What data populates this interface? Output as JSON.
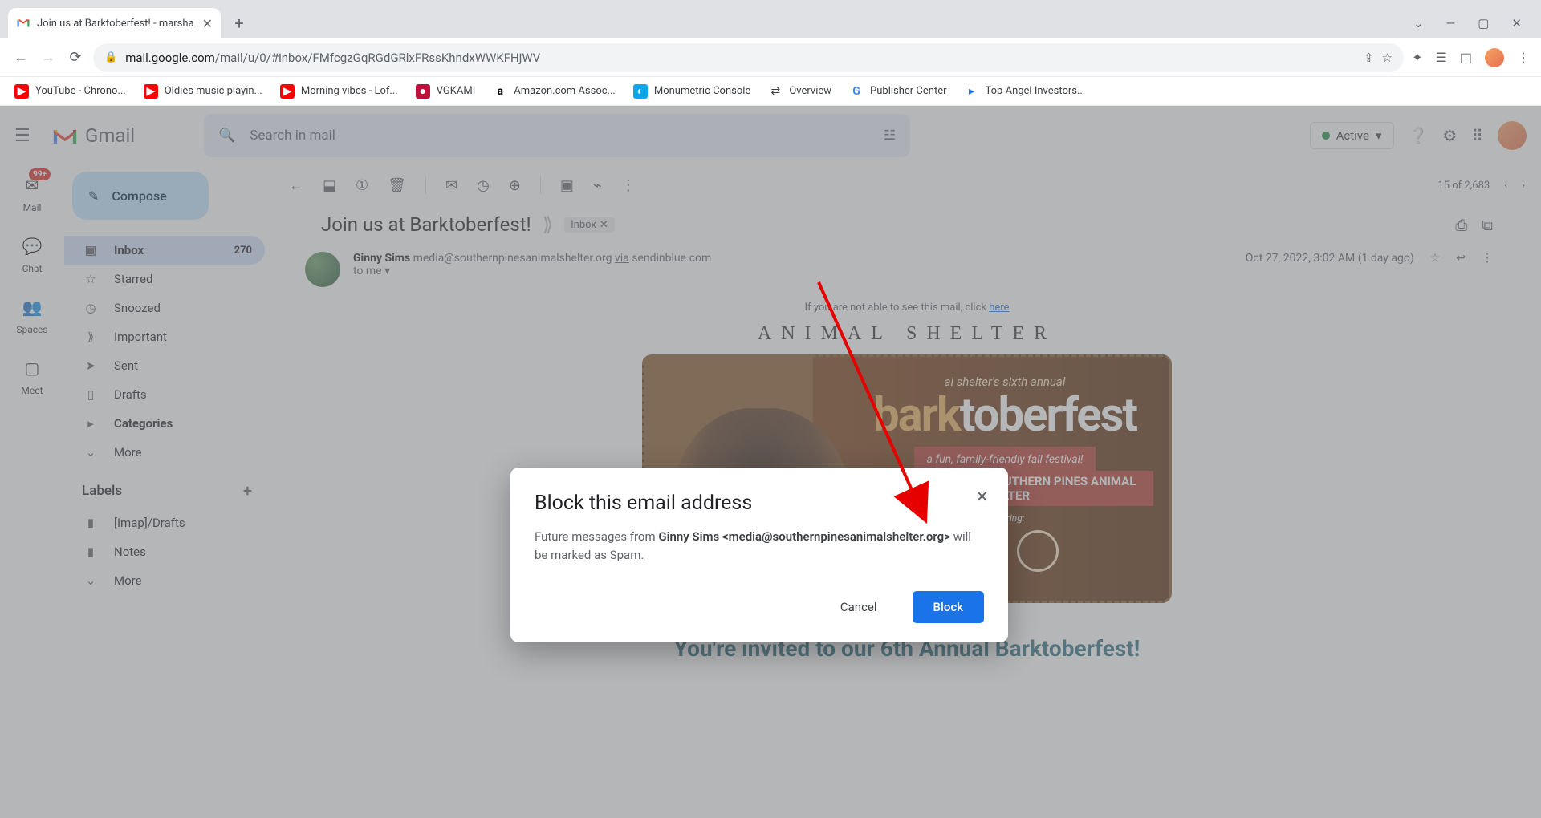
{
  "browser": {
    "tab_title": "Join us at Barktoberfest! - marsha",
    "url_domain": "mail.google.com",
    "url_path": "/mail/u/0/#inbox/FMfcgzGqRGdGRlxFRssKhndxWWKFHjWV",
    "bookmarks": [
      {
        "label": "YouTube - Chrono..."
      },
      {
        "label": "Oldies music playin..."
      },
      {
        "label": "Morning vibes - Lof..."
      },
      {
        "label": "VGKAMI"
      },
      {
        "label": "Amazon.com Assoc..."
      },
      {
        "label": "Monumetric Console"
      },
      {
        "label": "Overview"
      },
      {
        "label": "Publisher Center"
      },
      {
        "label": "Top Angel Investors..."
      }
    ]
  },
  "gmail": {
    "logo_text": "Gmail",
    "search_placeholder": "Search in mail",
    "status_label": "Active",
    "rail": [
      {
        "label": "Mail",
        "badge": "99+"
      },
      {
        "label": "Chat"
      },
      {
        "label": "Spaces"
      },
      {
        "label": "Meet"
      }
    ],
    "compose_label": "Compose",
    "folders": [
      {
        "label": "Inbox",
        "count": "270",
        "active": true
      },
      {
        "label": "Starred"
      },
      {
        "label": "Snoozed"
      },
      {
        "label": "Important"
      },
      {
        "label": "Sent"
      },
      {
        "label": "Drafts"
      },
      {
        "label": "Categories"
      },
      {
        "label": "More"
      }
    ],
    "labels_header": "Labels",
    "labels": [
      {
        "label": "[Imap]/Drafts"
      },
      {
        "label": "Notes"
      },
      {
        "label": "More"
      }
    ],
    "position": "15 of 2,683",
    "subject": "Join us at Barktoberfest!",
    "inbox_chip": "Inbox",
    "sender_name": "Ginny Sims",
    "sender_addr": "media@southernpinesanimalshelter.org",
    "via": "via",
    "via_domain": "sendinblue.com",
    "to_line": "to me",
    "timestamp": "Oct 27, 2022, 3:02 AM (1 day ago)",
    "cantsee_pre": "If you are not able to see this mail, click ",
    "cantsee_link": "here",
    "shelter_title": "ANIMAL SHELTER",
    "promo_small": "al shelter's sixth annual",
    "promo_big_left": "bark",
    "promo_big_right": "toberfest",
    "promo_ribbon1": "a fun, family-friendly fall festival!",
    "promo_ribbon2": "OCT. 27TH  ·  6-9PM  ·  SOUTHERN PINES ANIMAL SHELTER",
    "promo_feat": "featuring:",
    "invite": "You're invited to our 6th Annual Barktoberfest!"
  },
  "dialog": {
    "title": "Block this email address",
    "body_pre": "Future messages from ",
    "body_bold": "Ginny Sims <media@southernpinesanimalshelter.org>",
    "body_post": " will be marked as Spam.",
    "cancel": "Cancel",
    "block": "Block"
  }
}
